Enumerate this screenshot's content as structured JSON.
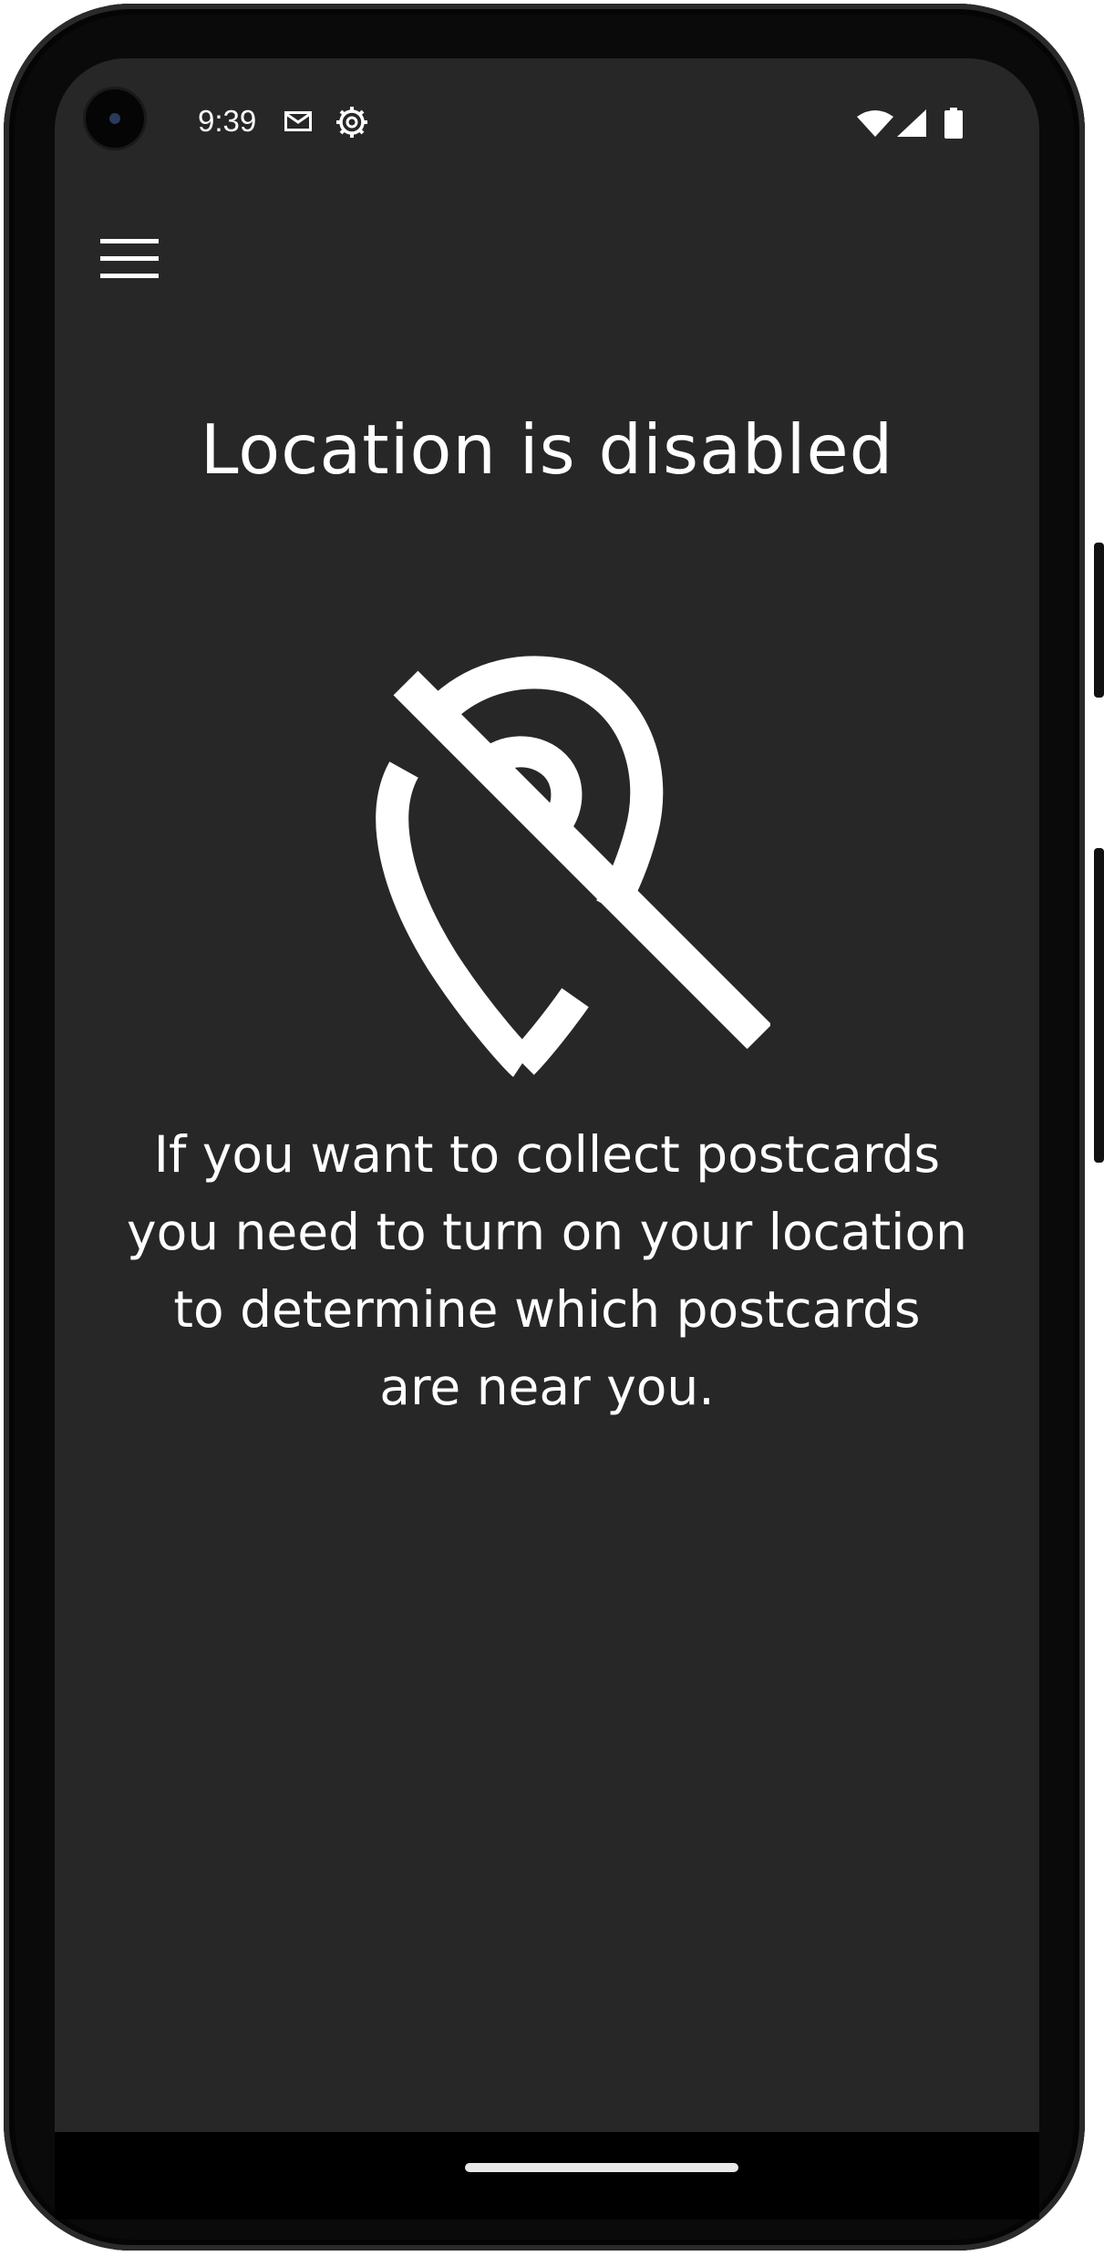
{
  "status_bar": {
    "time": "9:39",
    "icons": [
      "mail-icon",
      "settings-icon",
      "wifi-icon",
      "signal-icon",
      "battery-icon"
    ]
  },
  "toolbar": {
    "menu_icon": "hamburger-menu-icon"
  },
  "main": {
    "title": "Location is disabled",
    "illustration_icon": "location-off-icon",
    "message_lines": [
      "If you want to collect postcards",
      "you need to turn on your location",
      "to determine which postcards",
      "are near you."
    ]
  },
  "colors": {
    "background": "#272727",
    "foreground": "#ffffff"
  }
}
